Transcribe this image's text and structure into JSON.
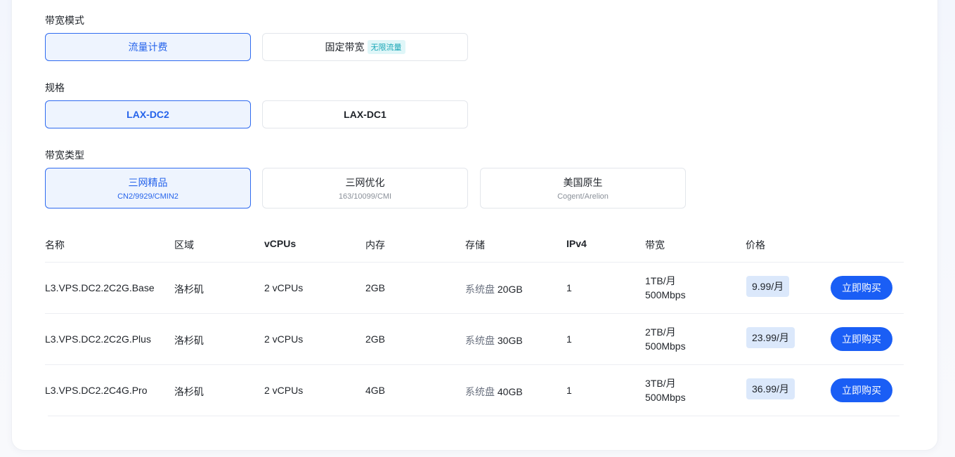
{
  "bandwidth_mode": {
    "label": "带宽模式",
    "options": [
      {
        "label": "流量计费",
        "selected": true
      },
      {
        "label": "固定带宽",
        "tag": "无限流量",
        "selected": false
      }
    ]
  },
  "spec": {
    "label": "规格",
    "options": [
      {
        "label": "LAX-DC2",
        "selected": true
      },
      {
        "label": "LAX-DC1",
        "selected": false
      }
    ]
  },
  "bandwidth_type": {
    "label": "带宽类型",
    "options": [
      {
        "label": "三网精品",
        "sub": "CN2/9929/CMIN2",
        "selected": true
      },
      {
        "label": "三网优化",
        "sub": "163/10099/CMI",
        "selected": false
      },
      {
        "label": "美国原生",
        "sub": "Cogent/Arelion",
        "selected": false
      }
    ]
  },
  "table": {
    "headers": {
      "name": "名称",
      "region": "区域",
      "vcpus": "vCPUs",
      "memory": "内存",
      "storage": "存储",
      "ipv4": "IPv4",
      "bandwidth": "带宽",
      "price": "价格"
    },
    "rows": [
      {
        "name": "L3.VPS.DC2.2C2G.Base",
        "region": "洛杉矶",
        "vcpus": "2 vCPUs",
        "memory": "2GB",
        "storage_label": "系统盘",
        "storage_value": "20GB",
        "ipv4": "1",
        "traffic": "1TB/月",
        "speed": "500Mbps",
        "price": "9.99/月",
        "buy": "立即购买"
      },
      {
        "name": "L3.VPS.DC2.2C2G.Plus",
        "region": "洛杉矶",
        "vcpus": "2 vCPUs",
        "memory": "2GB",
        "storage_label": "系统盘",
        "storage_value": "30GB",
        "ipv4": "1",
        "traffic": "2TB/月",
        "speed": "500Mbps",
        "price": "23.99/月",
        "buy": "立即购买"
      },
      {
        "name": "L3.VPS.DC2.2C4G.Pro",
        "region": "洛杉矶",
        "vcpus": "2 vCPUs",
        "memory": "4GB",
        "storage_label": "系统盘",
        "storage_value": "40GB",
        "ipv4": "1",
        "traffic": "3TB/月",
        "speed": "500Mbps",
        "price": "36.99/月",
        "buy": "立即购买"
      }
    ]
  },
  "colors": {
    "accent": "#1a5ef5",
    "selected_bg": "#eef4fe",
    "selected_border": "#2f6bf0",
    "price_bg": "#dbe8fb",
    "tag_text": "#19a6b6",
    "tag_bg": "#dff6f8"
  }
}
